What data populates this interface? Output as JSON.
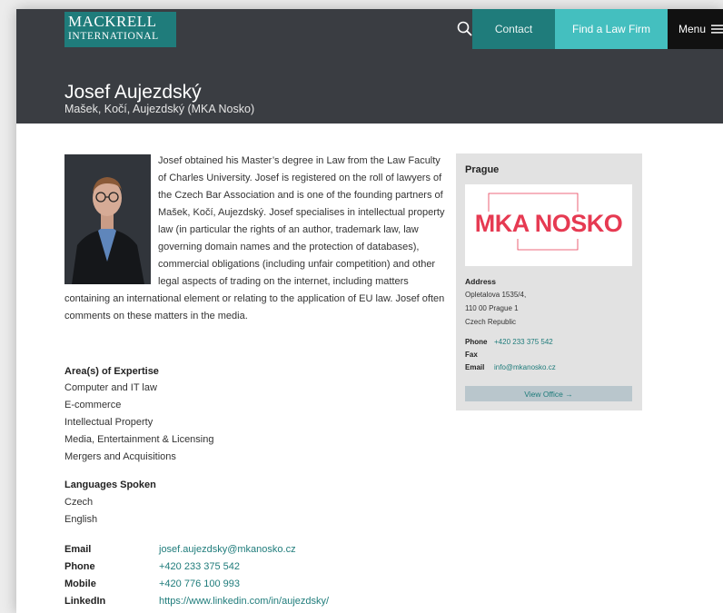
{
  "header": {
    "logo_line1": "MACKRELL",
    "logo_line2": "INTERNATIONAL",
    "contact_label": "Contact",
    "find_firm_label": "Find a Law Firm",
    "menu_label": "Menu"
  },
  "profile": {
    "name": "Josef Aujezdský",
    "firm": "Mašek, Kočí, Aujezdský (MKA Nosko)",
    "bio": "Josef obtained his Master’s degree in Law from the Law Faculty of Charles University. Josef is registered on the roll of lawyers of the Czech Bar Association and is one of the founding partners of Mašek, Kočí, Aujezdský. Josef specialises in intellectual property law (in particular the rights of an author, trademark law, law governing domain names and the protection of databases), commercial obligations (including unfair competition) and other legal aspects of trading on the internet, including matters containing an international element or relating to the application of EU law. Josef often comments on these matters in the media."
  },
  "expertise": {
    "title": "Area(s) of Expertise",
    "items": [
      "Computer and IT law",
      "E-commerce",
      "Intellectual Property",
      "Media, Entertainment & Licensing",
      "Mergers and Acquisitions"
    ]
  },
  "languages": {
    "title": "Languages Spoken",
    "items": [
      "Czech",
      "English"
    ]
  },
  "contact": {
    "email_label": "Email",
    "email": "josef.aujezdsky@mkanosko.cz",
    "phone_label": "Phone",
    "phone": "+420 233 375 542",
    "mobile_label": "Mobile",
    "mobile": "+420 776 100 993",
    "linkedin_label": "LinkedIn",
    "linkedin": "https://www.linkedin.com/in/aujezdsky/"
  },
  "office": {
    "city": "Prague",
    "logo_text": "MKA NOSKO",
    "address_label": "Address",
    "address_lines": [
      "Opletalova 1535/4,",
      "110 00 Prague 1",
      "Czech Republic"
    ],
    "phone_label": "Phone",
    "phone": "+420 233 375 542",
    "fax_label": "Fax",
    "fax": "",
    "email_label": "Email",
    "email": "info@mkanosko.cz",
    "view_office_label": "View Office →"
  },
  "colors": {
    "header_bg": "#3a3d42",
    "brand_teal": "#1f7c7b",
    "accent_teal": "#44bfbf",
    "logo_red": "#e63a52"
  }
}
